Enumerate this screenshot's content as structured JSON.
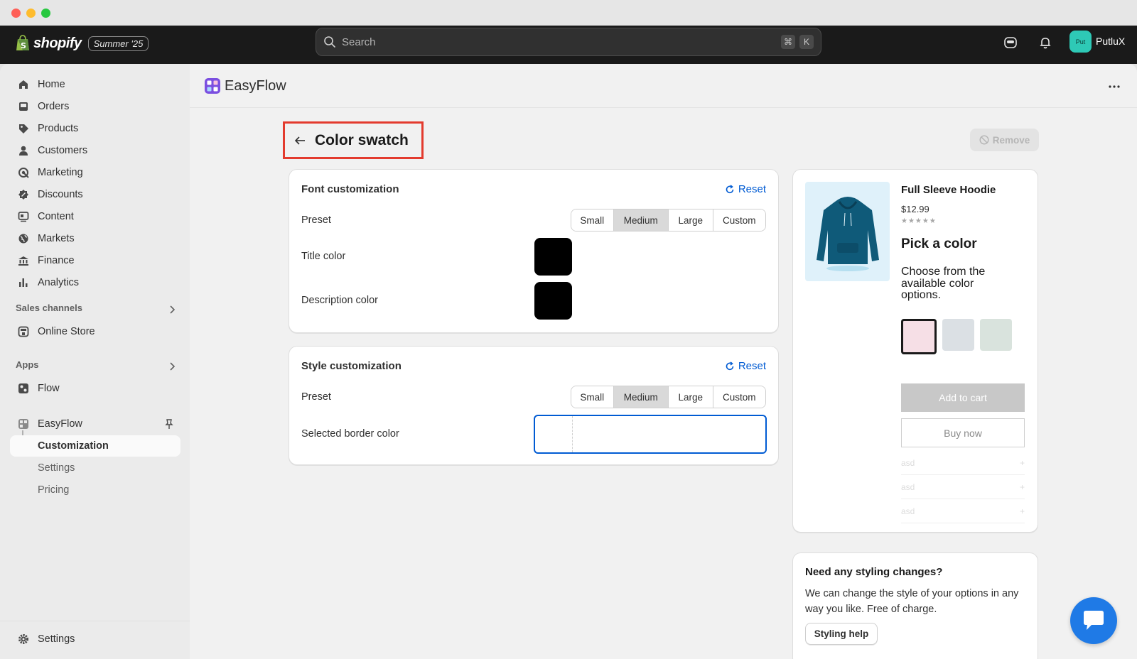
{
  "window": {
    "controls": [
      "close",
      "minimize",
      "maximize"
    ]
  },
  "topbar": {
    "brand": "shopify",
    "edition": "Summer '25",
    "search_placeholder": "Search",
    "shortcut_keys": [
      "⌘",
      "K"
    ],
    "user_initials": "Put",
    "user_name": "PutluX"
  },
  "sidebar": {
    "main_items": [
      {
        "label": "Home",
        "icon": "home-icon"
      },
      {
        "label": "Orders",
        "icon": "inbox-icon"
      },
      {
        "label": "Products",
        "icon": "tag-icon"
      },
      {
        "label": "Customers",
        "icon": "person-icon"
      },
      {
        "label": "Marketing",
        "icon": "target-icon"
      },
      {
        "label": "Discounts",
        "icon": "discount-icon"
      },
      {
        "label": "Content",
        "icon": "content-icon"
      },
      {
        "label": "Markets",
        "icon": "globe-icon"
      },
      {
        "label": "Finance",
        "icon": "bank-icon"
      },
      {
        "label": "Analytics",
        "icon": "bar-chart-icon"
      }
    ],
    "sales_channels_label": "Sales channels",
    "online_store": "Online Store",
    "apps_label": "Apps",
    "flow": "Flow",
    "easyflow": "EasyFlow",
    "sub_items": [
      "Customization",
      "Settings",
      "Pricing"
    ],
    "settings": "Settings"
  },
  "app": {
    "title": "EasyFlow"
  },
  "page": {
    "title": "Color swatch",
    "remove_label": "Remove"
  },
  "font_card": {
    "title": "Font customization",
    "reset": "Reset",
    "preset_label": "Preset",
    "presets": [
      "Small",
      "Medium",
      "Large",
      "Custom"
    ],
    "selected_preset": "Medium",
    "title_color_label": "Title color",
    "title_color": "#000000",
    "description_color_label": "Description color",
    "description_color": "#000000"
  },
  "style_card": {
    "title": "Style customization",
    "reset": "Reset",
    "preset_label": "Preset",
    "presets": [
      "Small",
      "Medium",
      "Large",
      "Custom"
    ],
    "selected_preset": "Medium",
    "border_color_label": "Selected border color"
  },
  "preview": {
    "product_name": "Full Sleeve Hoodie",
    "price": "$12.99",
    "stars": "★★★★★",
    "pick_title": "Pick a color",
    "pick_desc": "Choose from the available color options.",
    "options": [
      "#f6dfe6",
      "#dbe0e4",
      "#d9e3dd"
    ],
    "add_to_cart": "Add to cart",
    "buy_now": "Buy now",
    "accordion": [
      {
        "label": "asd",
        "toggle": "+"
      },
      {
        "label": "asd",
        "toggle": "+"
      },
      {
        "label": "asd",
        "toggle": "+"
      }
    ]
  },
  "help": {
    "title": "Need any styling changes?",
    "text": "We can change the style of your options in any way you like. Free of charge.",
    "button": "Styling help"
  },
  "colors": {
    "accent": "#005bd3",
    "highlight": "#e33b2e",
    "chat": "#1f7ae6"
  }
}
